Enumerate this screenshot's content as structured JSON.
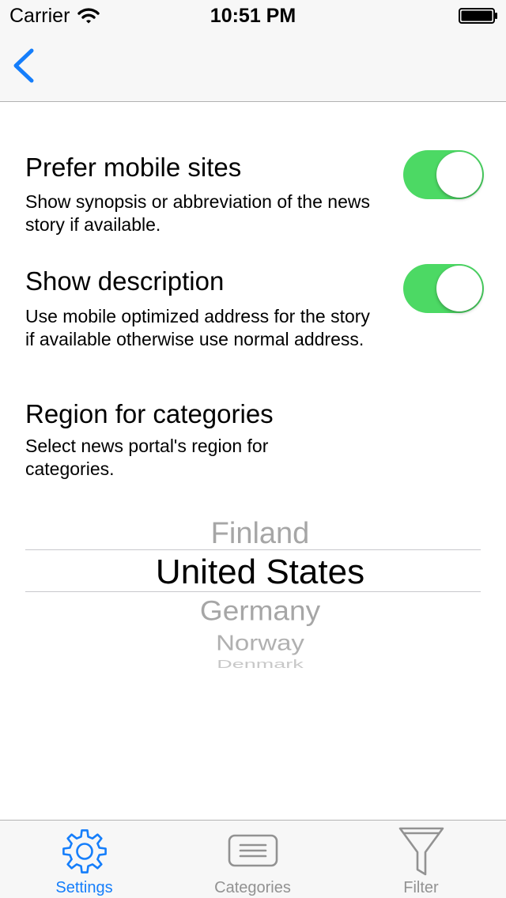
{
  "status_bar": {
    "carrier": "Carrier",
    "time": "10:51 PM"
  },
  "nav_bar": {
    "back_icon": "chevron-left-icon"
  },
  "settings": [
    {
      "title": "Prefer mobile sites",
      "description": "Show synopsis or abbreviation of the news story if available.",
      "toggle_on": true
    },
    {
      "title": "Show description",
      "description": "Use mobile optimized address for the story if available otherwise use normal address.",
      "toggle_on": true
    },
    {
      "title": "Region for categories",
      "description": "Select news portal's region for categories."
    }
  ],
  "region_picker": {
    "options": [
      "Finland",
      "United States",
      "Germany",
      "Norway",
      "Denmark"
    ],
    "selected": "United States"
  },
  "tab_bar": {
    "items": [
      {
        "label": "Settings",
        "icon": "gear-icon",
        "active": true
      },
      {
        "label": "Categories",
        "icon": "list-icon",
        "active": false
      },
      {
        "label": "Filter",
        "icon": "funnel-icon",
        "active": false
      }
    ]
  },
  "colors": {
    "accent": "#157efb",
    "toggle_on": "#4cd964",
    "inactive_tab": "#929292",
    "bar_background": "#f7f7f7"
  }
}
